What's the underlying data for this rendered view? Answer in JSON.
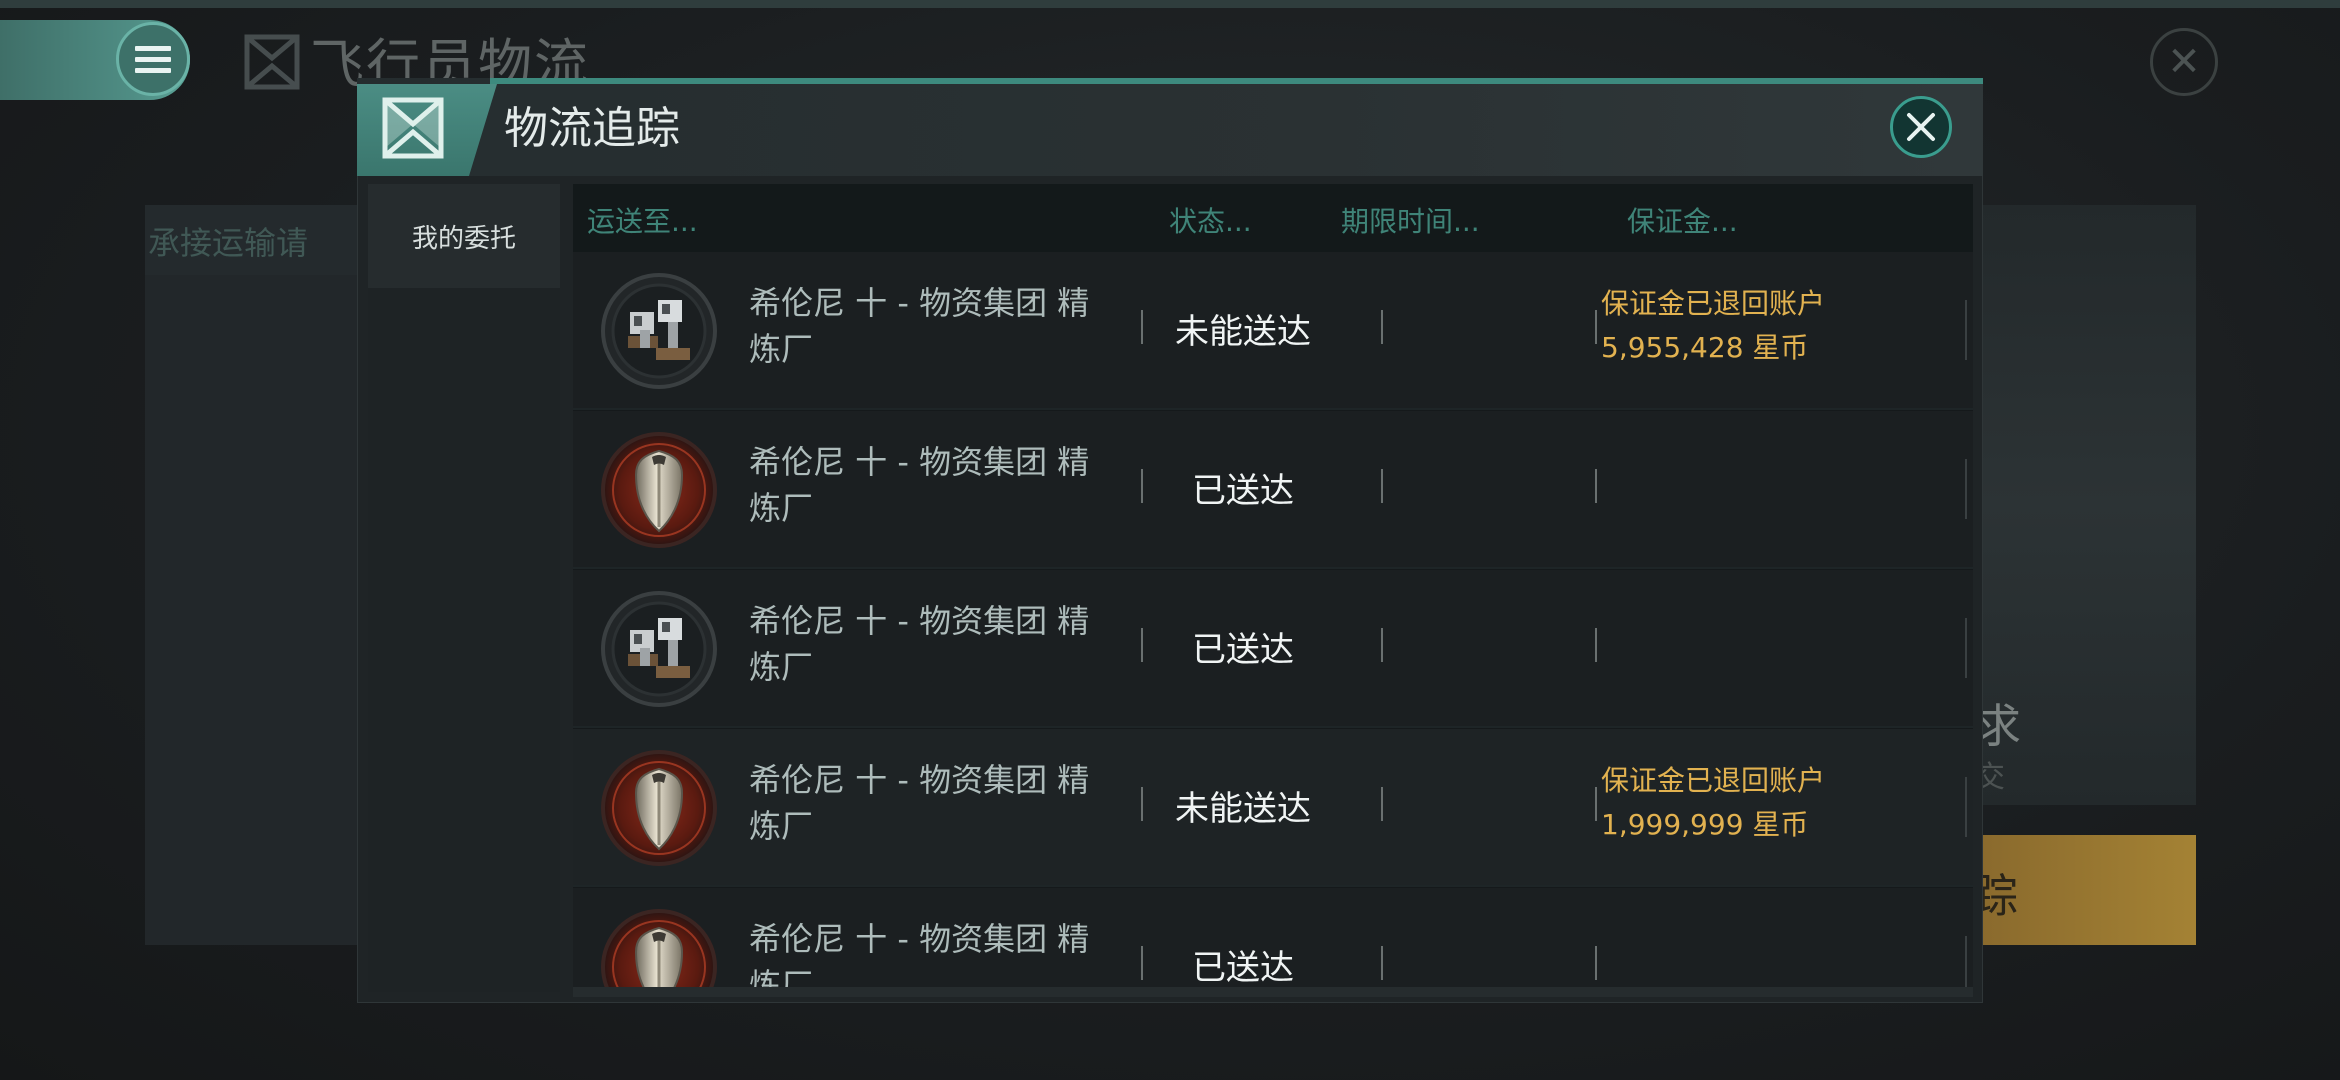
{
  "background": {
    "title": "飞行员物流",
    "left_label": "承接运输请",
    "right_text1": "求",
    "right_text2": "交",
    "gold_button_text": "踪"
  },
  "dialog": {
    "title": "物流追踪",
    "side_tab": "我的委托",
    "columns": [
      "运送至...",
      "状态...",
      "期限时间...",
      "保证金..."
    ],
    "rows": [
      {
        "icon": "turret-icon",
        "destination": "希伦尼 十 - 物资集团 精炼厂",
        "status": "未能送达",
        "deadline": "",
        "deposit_line1": "保证金已退回账户",
        "deposit_line2": "5,955,428 星币"
      },
      {
        "icon": "shield-icon",
        "destination": "希伦尼 十 - 物资集团 精炼厂",
        "status": "已送达",
        "deadline": "",
        "deposit_line1": "",
        "deposit_line2": ""
      },
      {
        "icon": "turret-icon",
        "destination": "希伦尼 十 - 物资集团 精炼厂",
        "status": "已送达",
        "deadline": "",
        "deposit_line1": "",
        "deposit_line2": ""
      },
      {
        "icon": "shield-icon",
        "destination": "希伦尼 十 - 物资集团 精炼厂",
        "status": "未能送达",
        "deadline": "",
        "deposit_line1": "保证金已退回账户",
        "deposit_line2": "1,999,999 星币"
      },
      {
        "icon": "shield-icon",
        "destination": "希伦尼 十 - 物资集团 精炼厂",
        "status": "已送达",
        "deadline": "",
        "deposit_line1": "",
        "deposit_line2": ""
      }
    ]
  },
  "colors": {
    "accent": "#4b8d84",
    "deposit_text": "#e2b250",
    "header_text": "#3f8478"
  }
}
